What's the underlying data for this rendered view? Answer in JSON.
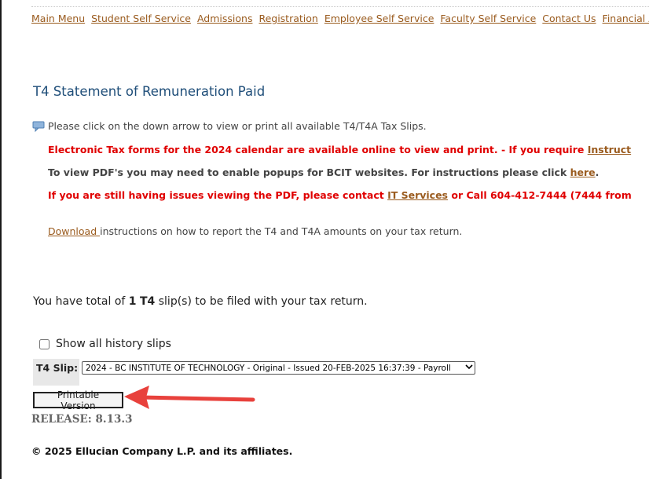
{
  "nav": {
    "items": [
      "Main Menu",
      "Student Self Service",
      "Admissions",
      "Registration",
      "Employee Self Service",
      "Faculty Self Service",
      "Contact Us",
      "Financial Aid"
    ]
  },
  "page": {
    "title": "T4 Statement of Remuneration Paid",
    "info_text": "Please click on the down arrow to view or print all available T4/T4A Tax Slips."
  },
  "notices": {
    "electronic_text": "Electronic Tax forms for the 2024 calendar are available online to view and print. - If you require ",
    "electronic_link": "Instruct",
    "popup_text": "To view PDF's you may need to enable popups for BCIT websites. For instructions please click ",
    "popup_link": "here",
    "popup_end": ".",
    "issues_text": "If you are still having issues viewing the PDF, please contact ",
    "issues_link": "IT Services",
    "issues_end": " or Call 604-412-7444 (7444 from"
  },
  "download": {
    "link": "Download ",
    "text": "instructions on how to report the T4 and T4A amounts on your tax return."
  },
  "total": {
    "prefix": "You have total of ",
    "count": "1",
    "slip_type": "T4",
    "suffix": " slip(s) to be filed with your tax return."
  },
  "history": {
    "label": "Show all history slips",
    "checked": false
  },
  "slip": {
    "label": "T4 Slip:",
    "selected": "2024 - BC INSTITUTE OF TECHNOLOGY - Original - Issued 20-FEB-2025 16:37:39 - Payroll"
  },
  "buttons": {
    "printable": "Printable Version"
  },
  "footer": {
    "release": "RELEASE: 8.13.3",
    "copyright": "© 2025 Ellucian Company L.P. and its affiliates."
  },
  "colors": {
    "link": "#9a5b1e",
    "title": "#1f4e79",
    "alert": "#e00000",
    "annotation_arrow": "#e8413c"
  }
}
